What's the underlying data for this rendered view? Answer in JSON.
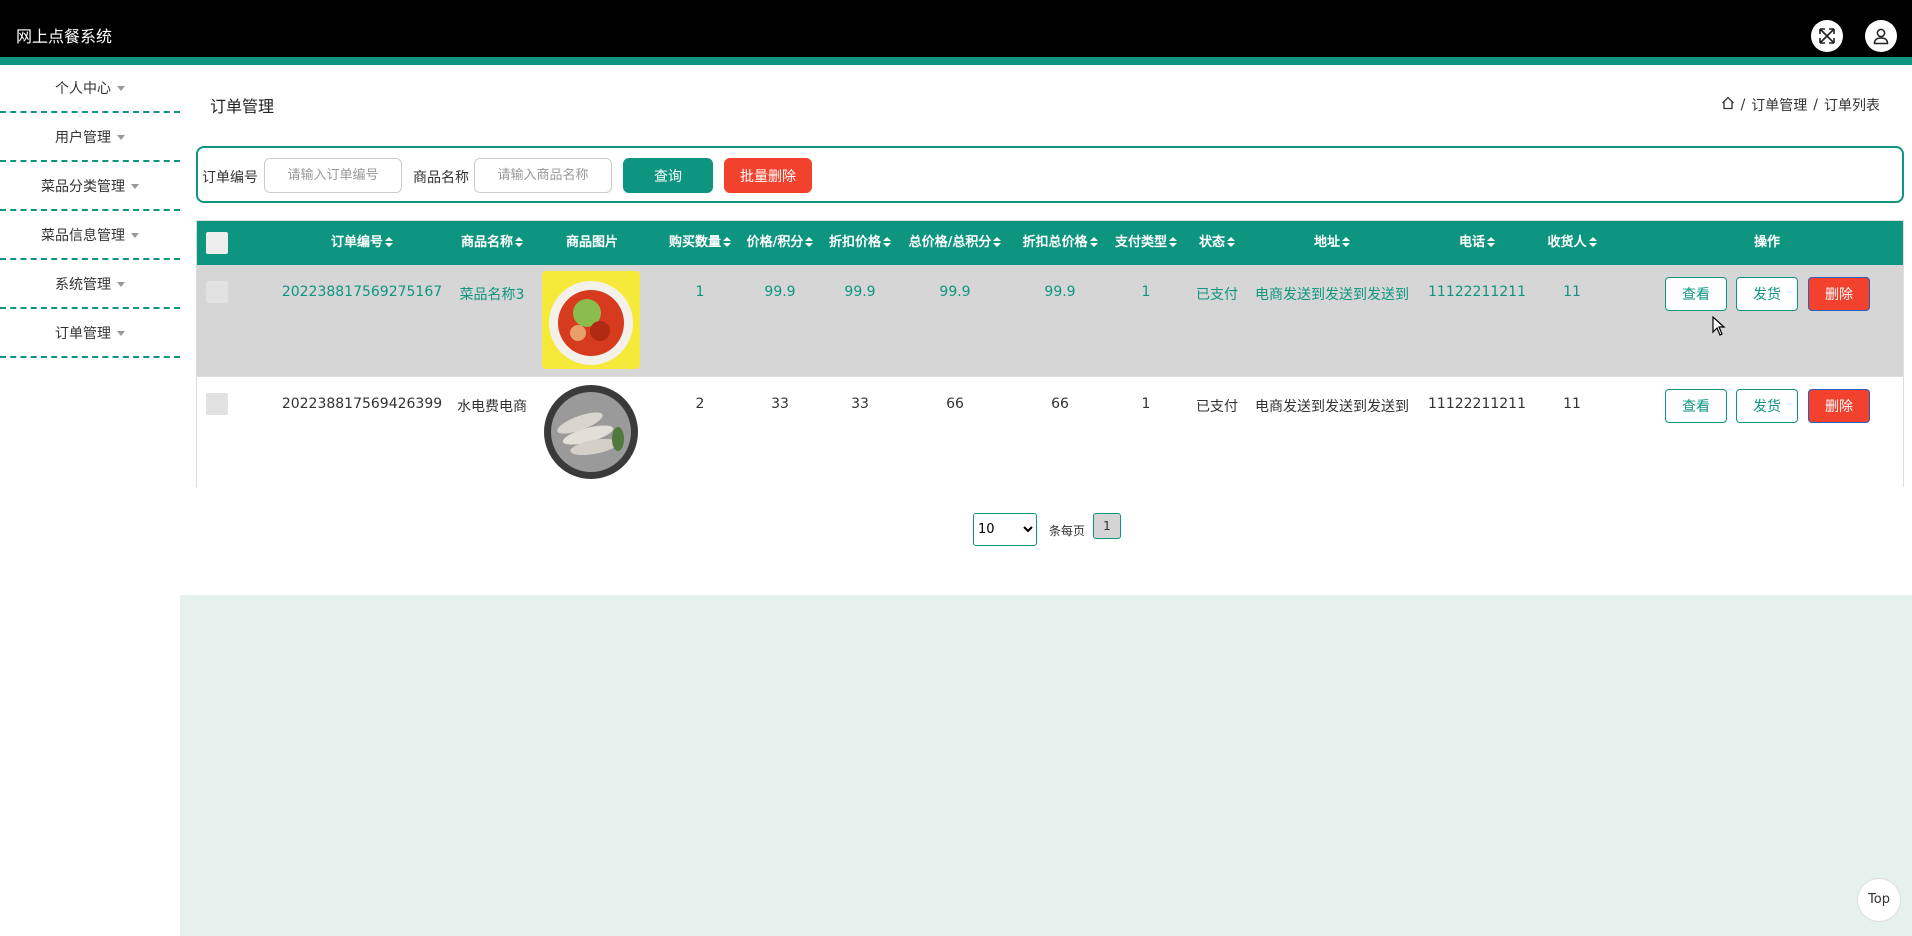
{
  "app": {
    "title": "网上点餐系统"
  },
  "header_icons": {
    "fullscreen": "fullscreen-icon",
    "user": "user-icon"
  },
  "sidebar": {
    "items": [
      {
        "label": "个人中心"
      },
      {
        "label": "用户管理"
      },
      {
        "label": "菜品分类管理"
      },
      {
        "label": "菜品信息管理"
      },
      {
        "label": "系统管理"
      },
      {
        "label": "订单管理"
      }
    ]
  },
  "page": {
    "title": "订单管理",
    "breadcrumb": {
      "sep": "/",
      "level1": "订单管理",
      "level2": "订单列表"
    }
  },
  "search": {
    "order_no_label": "订单编号",
    "order_no_placeholder": "请输入订单编号",
    "product_label": "商品名称",
    "product_placeholder": "请输入商品名称",
    "query_button": "查询",
    "batch_delete_button": "批量删除"
  },
  "table": {
    "columns": [
      "订单编号",
      "商品名称",
      "商品图片",
      "购买数量",
      "价格/积分",
      "折扣价格",
      "总价格/总积分",
      "折扣总价格",
      "支付类型",
      "状态",
      "地址",
      "电话",
      "收货人",
      "操作"
    ],
    "rows": [
      {
        "order_no": "202238817569275167",
        "product": "菜品名称3",
        "image": "noodle-dish-photo",
        "qty": "1",
        "price": "99.9",
        "discount_price": "99.9",
        "total": "99.9",
        "discount_total": "99.9",
        "pay_type": "1",
        "status": "已支付",
        "address": "电商发送到发送到发送到",
        "phone": "11122211211",
        "receiver": "11"
      },
      {
        "order_no": "202238817569426399",
        "product": "水电费电商",
        "image": "shrimp-dish-photo",
        "qty": "2",
        "price": "33",
        "discount_price": "33",
        "total": "66",
        "discount_total": "66",
        "pay_type": "1",
        "status": "已支付",
        "address": "电商发送到发送到发送到",
        "phone": "11122211211",
        "receiver": "11"
      }
    ],
    "actions": {
      "view": "查看",
      "ship": "发货",
      "delete": "删除"
    }
  },
  "pagination": {
    "page_size": "10",
    "page_size_options": [
      "10"
    ],
    "per_page_label": "条每页",
    "current_page": "1"
  },
  "back_to_top": "Top",
  "colors": {
    "accent": "#0e9580",
    "danger": "#f2422e",
    "header_bg": "#000000"
  }
}
